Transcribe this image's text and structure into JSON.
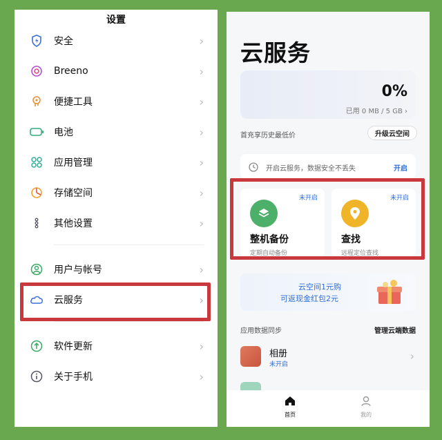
{
  "settings": {
    "title": "设置",
    "items": [
      {
        "label": "安全",
        "icon": "shield-icon"
      },
      {
        "label": "Breeno",
        "icon": "breeno-icon"
      },
      {
        "label": "便捷工具",
        "icon": "tools-icon"
      },
      {
        "label": "电池",
        "icon": "battery-icon"
      },
      {
        "label": "应用管理",
        "icon": "apps-icon"
      },
      {
        "label": "存储空间",
        "icon": "storage-icon"
      },
      {
        "label": "其他设置",
        "icon": "more-settings-icon"
      },
      {
        "label": "用户与帐号",
        "icon": "user-icon"
      },
      {
        "label": "云服务",
        "icon": "cloud-icon"
      },
      {
        "label": "软件更新",
        "icon": "update-icon"
      },
      {
        "label": "关于手机",
        "icon": "info-icon"
      }
    ]
  },
  "cloud": {
    "title": "云服务",
    "storage": {
      "percent": "0%",
      "used": "已用 0 MB / 5 GB",
      "used_fraction": 0
    },
    "promo": "首充享历史最低价",
    "upgrade_label": "升级云空间",
    "notice": {
      "text": "开启云服务，数据安全不丢失",
      "action": "开启"
    },
    "cards": [
      {
        "title": "整机备份",
        "subtitle": "定期自动备份",
        "status": "未开启",
        "icon": "layers-icon",
        "color": "#4caf6a"
      },
      {
        "title": "查找",
        "subtitle": "远程定位查找",
        "status": "未开启",
        "icon": "location-pin-icon",
        "color": "#f0b429"
      }
    ],
    "banner": {
      "line1": "云空间1元购",
      "line2": "可返现金红包2元"
    },
    "sync_label": "应用数据同步",
    "manage_label": "管理云端数据",
    "album": {
      "title": "相册",
      "status": "未开启"
    },
    "tabs": [
      {
        "label": "首页",
        "icon": "home-icon",
        "active": true
      },
      {
        "label": "我的",
        "icon": "profile-icon",
        "active": false
      }
    ]
  },
  "colors": {
    "background": "#6aa84f",
    "highlight": "#c9383c",
    "accent": "#2f6fd6"
  }
}
